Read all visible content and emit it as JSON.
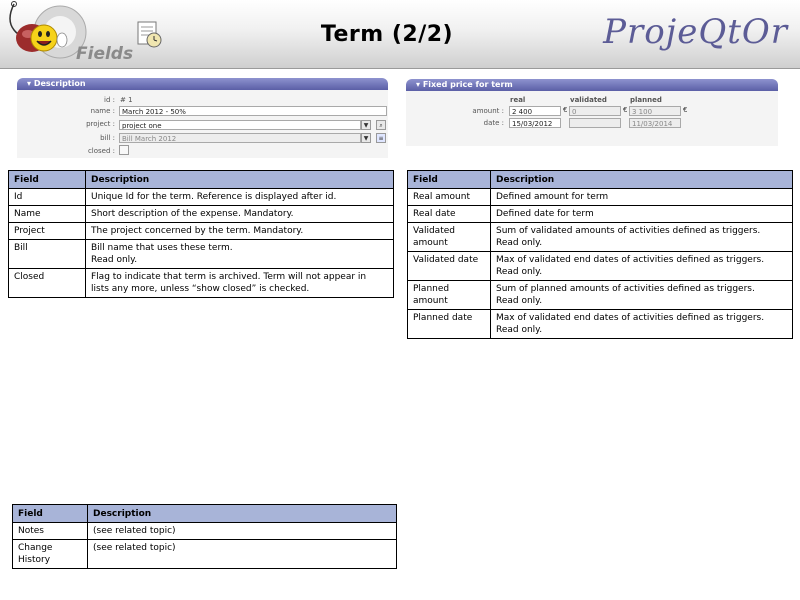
{
  "header": {
    "title": "Term (2/2)",
    "logo_word": "Fields",
    "brand": "ProjeQtOr"
  },
  "description_panel": {
    "title": "Description",
    "fields": {
      "id_label": "id :",
      "id_value": "# 1",
      "name_label": "name :",
      "name_value": "March 2012 - 50%",
      "project_label": "project :",
      "project_value": "project one",
      "bill_label": "bill :",
      "bill_value": "Bill March 2012",
      "closed_label": "closed :"
    }
  },
  "fixed_price_panel": {
    "title": "Fixed price for term",
    "columns": [
      "real",
      "validated",
      "planned"
    ],
    "amount_label": "amount :",
    "date_label": "date :",
    "amount": {
      "real": "2 400",
      "validated": "0",
      "planned": "3 100"
    },
    "date": {
      "real": "15/03/2012",
      "validated": "",
      "planned": "11/03/2014"
    },
    "currency": "€"
  },
  "table_left": {
    "headers": [
      "Field",
      "Description"
    ],
    "rows": [
      {
        "field": "Id",
        "desc": [
          "Unique Id for the term. Reference is displayed after id."
        ]
      },
      {
        "field": "Name",
        "desc": [
          "Short description of the expense. Mandatory."
        ]
      },
      {
        "field": "Project",
        "desc": [
          "The project concerned by the term. Mandatory."
        ]
      },
      {
        "field": "Bill",
        "desc": [
          "Bill name that uses these term.",
          "Read only."
        ]
      },
      {
        "field": "Closed",
        "desc": [
          "Flag to indicate that term is archived. Term will not appear in",
          "lists any more, unless “show closed” is checked."
        ]
      }
    ]
  },
  "table_right": {
    "headers": [
      "Field",
      "Description"
    ],
    "rows": [
      {
        "field": [
          "Real amount"
        ],
        "desc": [
          "Defined amount for term"
        ]
      },
      {
        "field": [
          "Real date"
        ],
        "desc": [
          "Defined date for term"
        ]
      },
      {
        "field": [
          "Validated",
          "amount"
        ],
        "desc": [
          "Sum of validated amounts of activities defined as triggers.",
          "Read only."
        ]
      },
      {
        "field": [
          "Validated date"
        ],
        "desc": [
          "Max of validated end dates of activities defined as triggers.",
          "Read only."
        ]
      },
      {
        "field": [
          "Planned",
          "amount"
        ],
        "desc": [
          "Sum of planned amounts of activities defined as triggers.",
          "Read only."
        ]
      },
      {
        "field": [
          "Planned date"
        ],
        "desc": [
          "Max of validated end dates of activities defined as triggers.",
          "Read only."
        ]
      }
    ]
  },
  "table_bottom": {
    "headers": [
      "Field",
      "Description"
    ],
    "rows": [
      {
        "field": [
          "Notes"
        ],
        "desc": [
          "(see related topic)"
        ]
      },
      {
        "field": [
          "Change",
          "History"
        ],
        "desc": [
          "(see related topic)"
        ]
      }
    ]
  },
  "colors": {
    "table_header": "#a8b4d8",
    "panel_bar": "#5b5fa6",
    "brand": "#5c5c96"
  }
}
